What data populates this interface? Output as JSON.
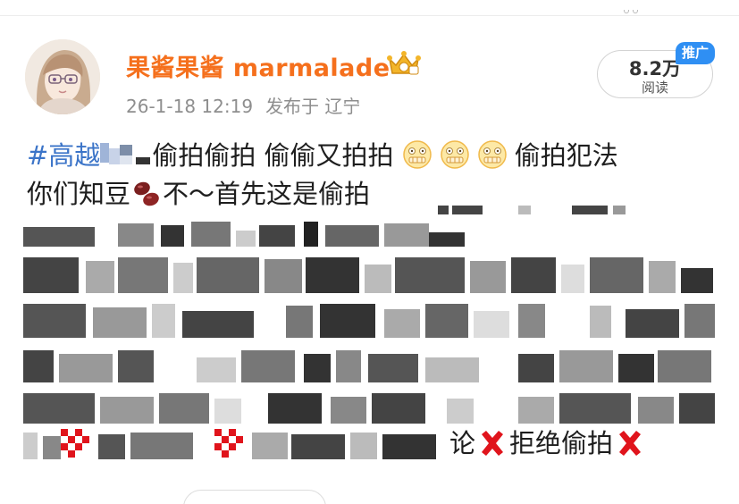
{
  "post": {
    "author": {
      "name": "果酱果酱 marmalade",
      "avatar_icon": "anime-girl-avatar",
      "badge_icon": "crown-icon"
    },
    "time": "26-1-18 12:19",
    "location": "发布于 辽宁",
    "reads": {
      "count": "8.2万",
      "label": "阅读"
    },
    "promo_badge": "推广",
    "content": {
      "hashtag_visible": "#高越",
      "line1_text": "偷拍偷拍 偷偷又拍拍",
      "line1_end": "偷拍犯法",
      "line2_start": "你们知豆",
      "line2_text": "不～首先这是偷拍",
      "tail_text": "论",
      "tail_end": "拒绝偷拍"
    }
  },
  "colors": {
    "username": "#f5701d",
    "hashtag": "#3b74c8",
    "meta": "#8e8e8e",
    "promo": "#2f8ff3",
    "x_mark": "#e0141c"
  }
}
